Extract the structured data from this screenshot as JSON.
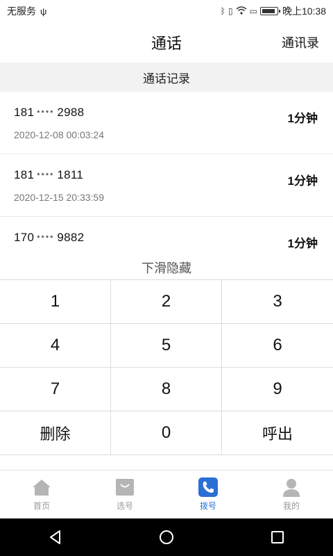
{
  "status_bar": {
    "carrier": "无服务",
    "time": "晚上10:38",
    "icons": [
      "usb-icon",
      "bluetooth-icon",
      "vibrate-icon",
      "wifi-icon",
      "sim-icon",
      "battery-icon"
    ],
    "battery_level": 0.9
  },
  "header": {
    "title": "通话",
    "contacts_label": "通讯录"
  },
  "section_title": "通话记录",
  "calls": [
    {
      "prefix": "181",
      "mask": "****",
      "suffix": "2988",
      "time": "2020-12-08 00:03:24",
      "duration": "1分钟"
    },
    {
      "prefix": "181",
      "mask": "****",
      "suffix": "1811",
      "time": "2020-12-15 20:33:59",
      "duration": "1分钟"
    },
    {
      "prefix": "170",
      "mask": "****",
      "suffix": "9882",
      "time": "",
      "duration": "1分钟"
    }
  ],
  "hide_hint": "下滑隐藏",
  "keypad": {
    "keys": [
      "1",
      "2",
      "3",
      "4",
      "5",
      "6",
      "7",
      "8",
      "9",
      "删除",
      "0",
      "呼出"
    ]
  },
  "tabs": [
    {
      "label": "首页",
      "icon": "home-icon",
      "active": false
    },
    {
      "label": "选号",
      "icon": "select-number-icon",
      "active": false
    },
    {
      "label": "拨号",
      "icon": "phone-icon",
      "active": true
    },
    {
      "label": "我的",
      "icon": "user-icon",
      "active": false
    }
  ],
  "colors": {
    "accent": "#2b6fd6",
    "inactive_tab": "#999999",
    "section_bg": "#f2f2f2"
  }
}
